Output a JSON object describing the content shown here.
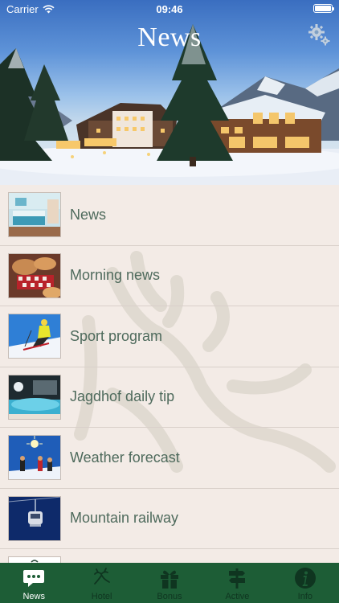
{
  "status": {
    "carrier": "Carrier",
    "time": "09:46"
  },
  "header": {
    "title": "News"
  },
  "rows": [
    {
      "label": "News"
    },
    {
      "label": "Morning news"
    },
    {
      "label": "Sport program"
    },
    {
      "label": "Jagdhof daily tip"
    },
    {
      "label": "Weather forecast"
    },
    {
      "label": "Mountain railway"
    }
  ],
  "tabs": [
    {
      "label": "News",
      "icon": "chat-bubble-icon",
      "active": true
    },
    {
      "label": "Hotel",
      "icon": "deer-icon",
      "active": false
    },
    {
      "label": "Bonus",
      "icon": "gift-icon",
      "active": false
    },
    {
      "label": "Active",
      "icon": "signpost-icon",
      "active": false
    },
    {
      "label": "Info",
      "icon": "info-icon",
      "active": false
    }
  ],
  "colors": {
    "tabbar": "#1d5d36",
    "list_bg": "#f3ebe6",
    "label": "#4e6a5c"
  }
}
